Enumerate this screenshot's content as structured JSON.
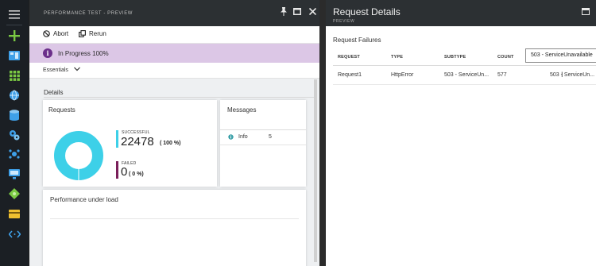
{
  "nav": {
    "items": [
      {
        "icon": "hamburger-menu-icon",
        "color": "#d0d0d0"
      },
      {
        "icon": "plus-icon",
        "color": "#7ac943"
      },
      {
        "icon": "dashboard-icon",
        "color": "#3fa0e8"
      },
      {
        "icon": "grid-icon",
        "color": "#7ac943"
      },
      {
        "icon": "globe-icon",
        "color": "#3fa0e8"
      },
      {
        "icon": "database-icon",
        "color": "#3fa0e8"
      },
      {
        "icon": "gears-icon",
        "color": "#3fa0e8"
      },
      {
        "icon": "network-icon",
        "color": "#3fa0e8"
      },
      {
        "icon": "monitor-icon",
        "color": "#3fa0e8"
      },
      {
        "icon": "puzzle-icon",
        "color": "#7ac943"
      },
      {
        "icon": "card-icon",
        "color": "#f0c030"
      },
      {
        "icon": "code-icon",
        "color": "#3fa0e8"
      }
    ]
  },
  "perf_blade": {
    "title": "PERFORMANCE TEST - PREVIEW",
    "toolbar": {
      "abort": "Abort",
      "rerun": "Rerun"
    },
    "status": {
      "text": "In Progress 100%",
      "icon_letter": "i"
    },
    "essentials": "Essentials",
    "details": "Details",
    "requests_card": {
      "title": "Requests",
      "successful_label": "SUCCESSFUL",
      "successful_count": "22478",
      "successful_pct": "( 100 %)",
      "failed_label": "FAILED",
      "failed_count": "0",
      "failed_pct": "( 0 %)",
      "success_fraction": 1.0,
      "success_color": "#3dd0e8",
      "failed_color": "#7a1f5a"
    },
    "messages_card": {
      "title": "Messages",
      "rows": [
        {
          "type": "Info",
          "count": "5"
        }
      ]
    },
    "perf_load_card": {
      "title": "Performance under load"
    }
  },
  "details_blade": {
    "title": "Request Details",
    "subtitle": "PREVIEW",
    "section": "Request Failures",
    "columns": [
      "REQUEST",
      "TYPE",
      "SUBTYPE",
      "COUNT"
    ],
    "rows": [
      {
        "request": "Request1",
        "type": "HttpError",
        "subtype": "503 - ServiceUn...",
        "count": "577",
        "detail": "503 - ServiceUn..."
      }
    ],
    "filter_value": "503 - ServiceUnavailable"
  }
}
